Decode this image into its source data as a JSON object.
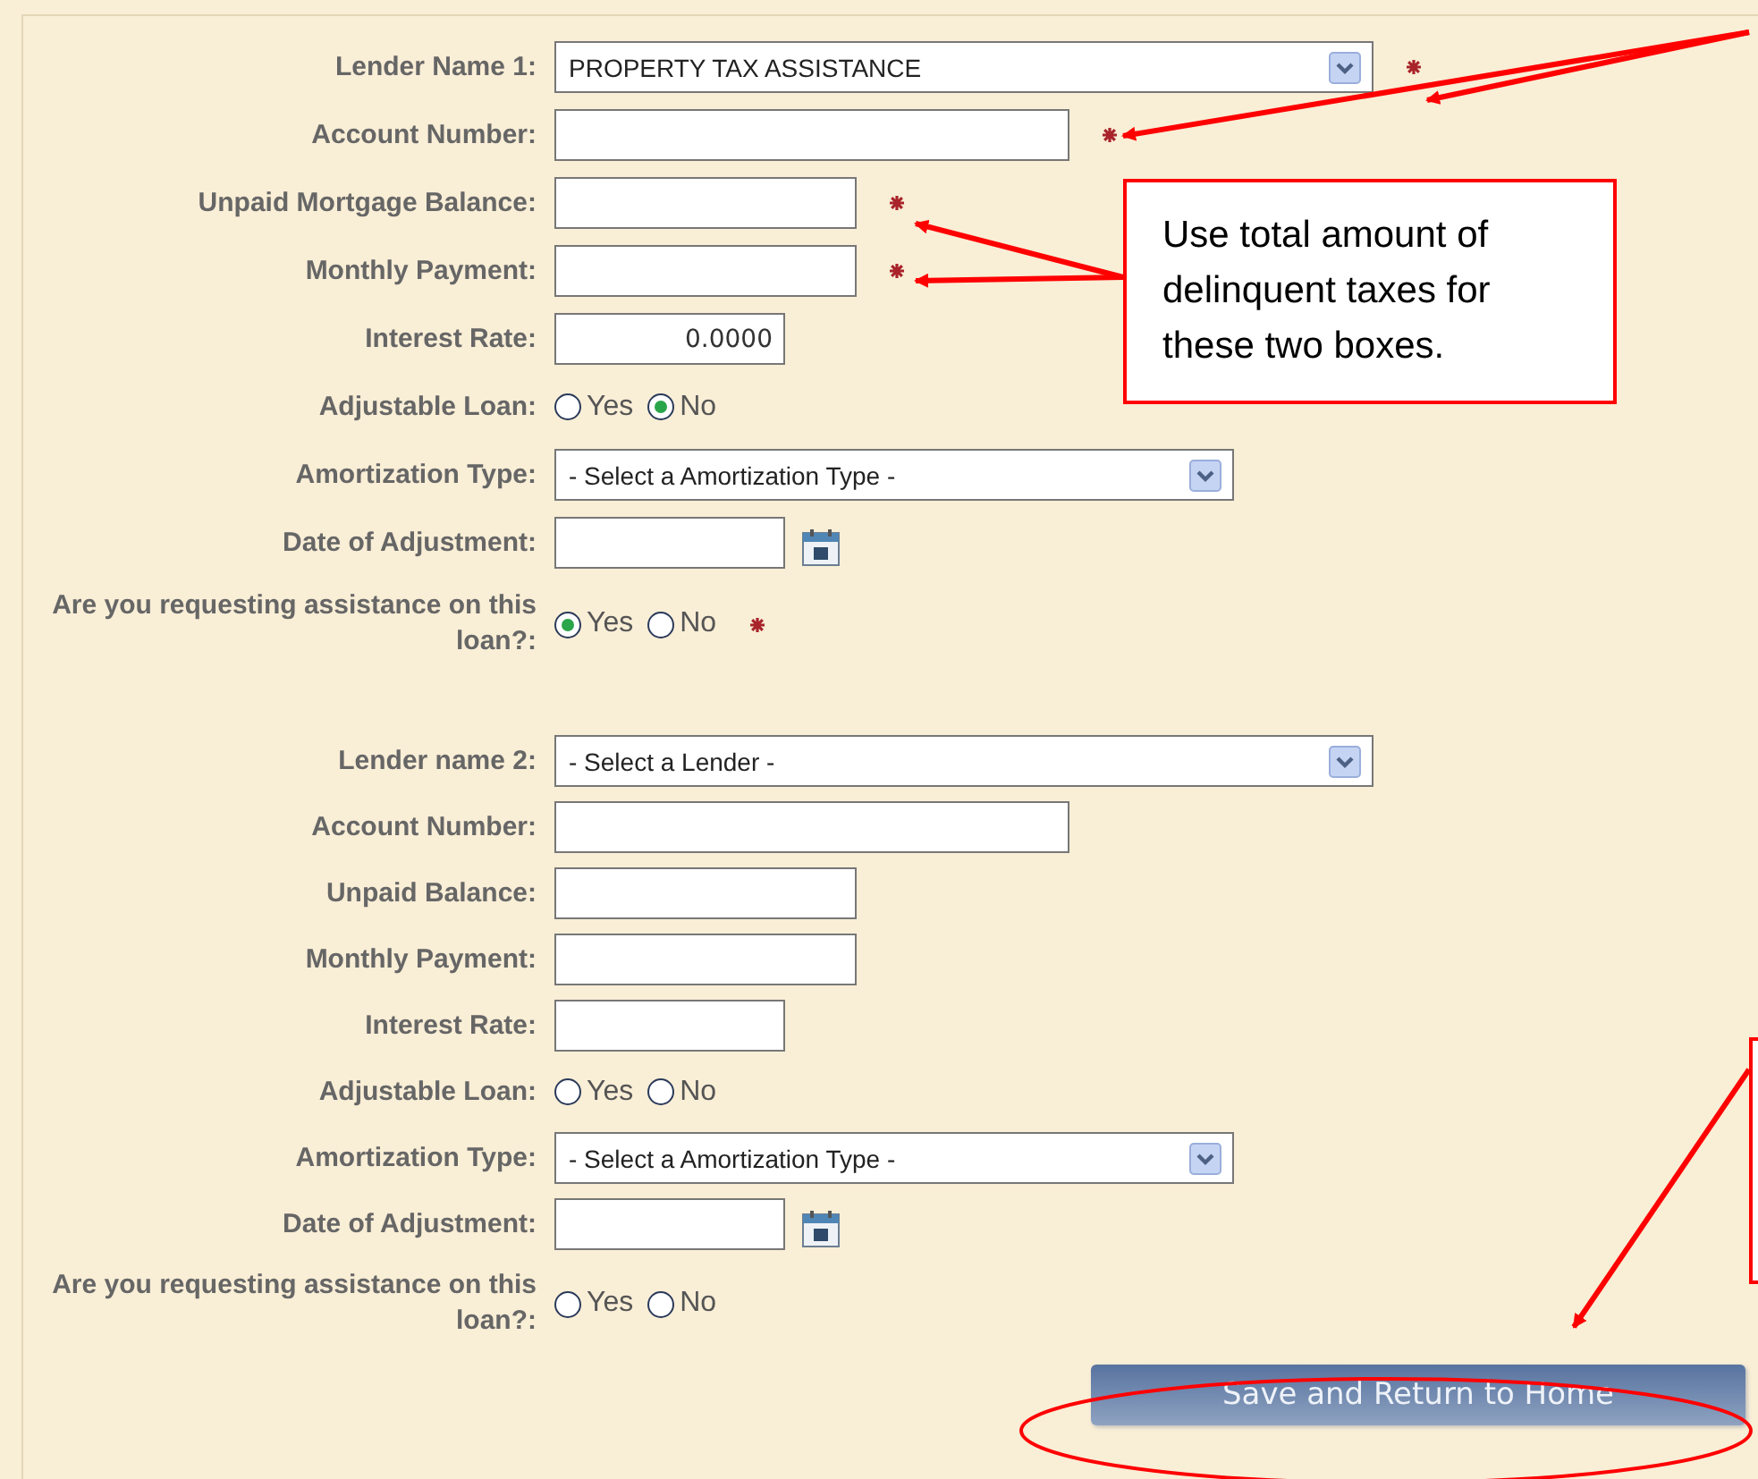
{
  "sections": [
    {
      "fields": [
        {
          "kind": "lender",
          "label": "Lender Name 1:",
          "value": "PROPERTY TAX ASSISTANCE",
          "required": true
        },
        {
          "kind": "account",
          "label": "Account Number:",
          "required": true
        },
        {
          "kind": "amount",
          "label": "Unpaid Mortgage Balance:",
          "required": true
        },
        {
          "kind": "amount",
          "label": "Monthly Payment:",
          "required": true
        },
        {
          "kind": "rate",
          "label": "Interest Rate:",
          "value": "0.0000"
        },
        {
          "kind": "radio",
          "label": "Adjustable Loan:",
          "options": [
            {
              "label": "Yes",
              "selected": false
            },
            {
              "label": "No",
              "selected": true
            }
          ]
        },
        {
          "kind": "amortization",
          "label": "Amortization Type:",
          "value": "- Select a Amortization Type -"
        },
        {
          "kind": "date",
          "label": "Date of Adjustment:"
        },
        {
          "kind": "radio",
          "label": "Are you requesting assistance on this loan?:",
          "required": true,
          "options": [
            {
              "label": "Yes",
              "selected": true
            },
            {
              "label": "No",
              "selected": false
            }
          ]
        }
      ]
    },
    {
      "fields": [
        {
          "kind": "lender",
          "label": "Lender name 2:",
          "value": "- Select a Lender -"
        },
        {
          "kind": "account",
          "label": "Account Number:"
        },
        {
          "kind": "amount",
          "label": "Unpaid Balance:"
        },
        {
          "kind": "amount",
          "label": "Monthly Payment:"
        },
        {
          "kind": "rate",
          "label": "Interest Rate:"
        },
        {
          "kind": "radio",
          "label": "Adjustable Loan:",
          "options": [
            {
              "label": "Yes",
              "selected": false
            },
            {
              "label": "No",
              "selected": false
            }
          ]
        },
        {
          "kind": "amortization",
          "label": "Amortization Type:",
          "value": "- Select a Amortization Type -"
        },
        {
          "kind": "date",
          "label": "Date of Adjustment:"
        },
        {
          "kind": "radio",
          "label": "Are you requesting assistance on this loan?:",
          "options": [
            {
              "label": "Yes",
              "selected": false
            },
            {
              "label": "No",
              "selected": false
            }
          ]
        }
      ]
    }
  ],
  "button": "Save and Return to Home",
  "callouts": [
    "Use total amount of delinquent taxes for these two boxes."
  ]
}
